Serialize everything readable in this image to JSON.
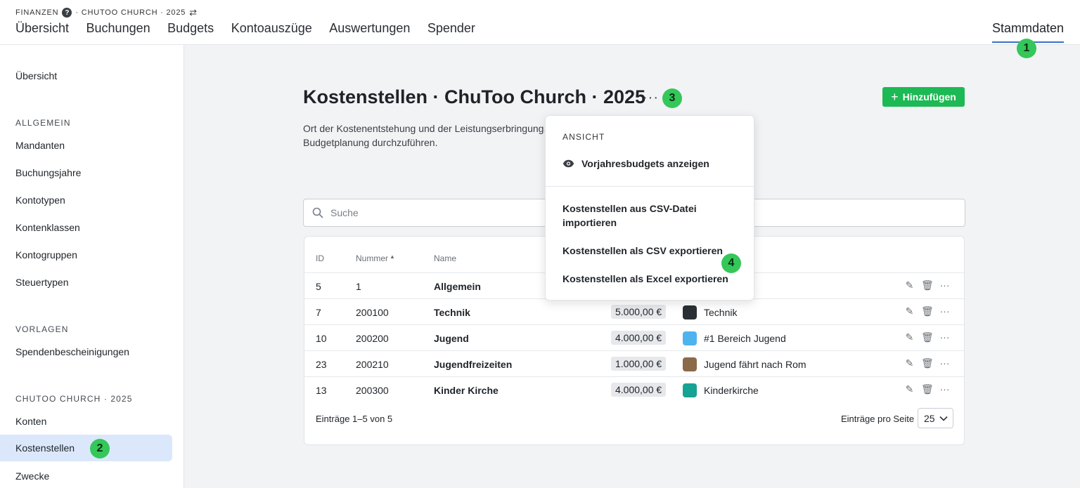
{
  "header": {
    "crumb_section": "FINANZEN",
    "crumb_context": "· CHUTOO CHURCH · 2025",
    "help_icon": "?",
    "swap_icon": "⇄",
    "nav": [
      "Übersicht",
      "Buchungen",
      "Budgets",
      "Kontoauszüge",
      "Auswertungen",
      "Spender"
    ],
    "nav_right": "Stammdaten"
  },
  "sidebar": {
    "overview": "Übersicht",
    "section_general": "ALLGEMEIN",
    "general": [
      "Mandanten",
      "Buchungsjahre",
      "Kontotypen",
      "Kontenklassen",
      "Kontogruppen",
      "Steuertypen"
    ],
    "section_templates": "VORLAGEN",
    "templates": [
      "Spendenbescheinigungen"
    ],
    "section_context": "CHUTOO CHURCH · 2025",
    "context": [
      "Konten",
      "Kostenstellen",
      "Zwecke"
    ],
    "active": "Kostenstellen"
  },
  "main": {
    "title": "Kostenstellen · ChuToo Church · 2025",
    "more": "···",
    "description": "Ort der Kostenentstehung und der Leistungserbringung. Budgetplanung durchzuführen.",
    "add_button": "Hinzufügen",
    "search_placeholder": "Suche"
  },
  "table": {
    "columns": [
      "ID",
      "Nummer",
      "Name"
    ],
    "sort_icon": "▲",
    "rows": [
      {
        "id": "5",
        "number": "1",
        "name": "Allgemein",
        "amount": "",
        "purpose": ""
      },
      {
        "id": "7",
        "number": "200100",
        "name": "Technik",
        "amount": "5.000,00 €",
        "purpose": "Technik"
      },
      {
        "id": "10",
        "number": "200200",
        "name": "Jugend",
        "amount": "4.000,00 €",
        "purpose": "#1 Bereich Jugend"
      },
      {
        "id": "23",
        "number": "200210",
        "name": "Jugendfreizeiten",
        "amount": "1.000,00 €",
        "purpose": "Jugend fährt nach Rom"
      },
      {
        "id": "13",
        "number": "200300",
        "name": "Kinder Kirche",
        "amount": "4.000,00 €",
        "purpose": "Kinderkirche"
      }
    ],
    "entries_label": "Einträge 1–5 von 5",
    "per_page_label": "Einträge pro Seite",
    "per_page_value": "25"
  },
  "dropdown": {
    "section": "ANSICHT",
    "show_prev_budgets": "Vorjahresbudgets anzeigen",
    "import_csv": "Kostenstellen aus CSV-Datei importieren",
    "export_csv": "Kostenstellen als CSV exportieren",
    "export_excel": "Kostenstellen als Excel exportieren"
  },
  "badges": [
    "1",
    "2",
    "3",
    "4"
  ],
  "colors": {
    "accent_green": "#1db954",
    "badge_green": "#34c759",
    "active_bg": "#dbe8fb",
    "tab_underline": "#3a72c4",
    "logo_technik": "#2b2f36",
    "logo_jugend": "#4fb3f0",
    "logo_freizeit": "#8b6a4a",
    "logo_kinder": "#17a394"
  },
  "icons": [
    "help-icon",
    "swap-icon",
    "search-icon",
    "plus-icon",
    "eye-icon",
    "edit-icon",
    "trash-icon",
    "more-icon",
    "chevron-down-icon",
    "sort-asc-icon"
  ]
}
